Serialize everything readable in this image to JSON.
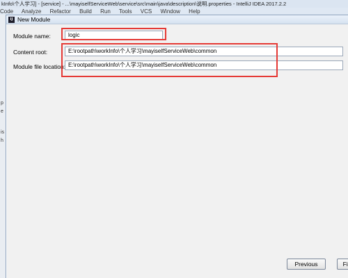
{
  "ide": {
    "window_title": "kInfo\\个人学习] - [service] - ...\\mayiselfServiceWeb\\service\\src\\main\\java\\description\\说明.properties - IntelliJ IDEA 2017.2.2",
    "menu": [
      "Code",
      "Analyze",
      "Refactor",
      "Build",
      "Run",
      "Tools",
      "VCS",
      "Window",
      "Help"
    ],
    "left_fragments": [
      "p",
      "e",
      "is",
      "h"
    ]
  },
  "dialog": {
    "icon_text": "IJ",
    "title": "New Module",
    "fields": {
      "module_name": {
        "label": "Module name:",
        "value": "logic"
      },
      "content_root": {
        "label": "Content root:",
        "value": "E:\\rootpath\\workInfo\\个人学习\\mayiselfServiceWeb\\common"
      },
      "module_file_location": {
        "label": "Module file location:",
        "value": "E:\\rootpath\\workInfo\\个人学习\\mayiselfServiceWeb\\common"
      }
    },
    "buttons": {
      "previous": "Previous",
      "finish": "Finish"
    }
  },
  "colors": {
    "highlight": "#e53935",
    "dialog_bg": "#f1f1f1",
    "titlebar": "#dbe5f1"
  }
}
